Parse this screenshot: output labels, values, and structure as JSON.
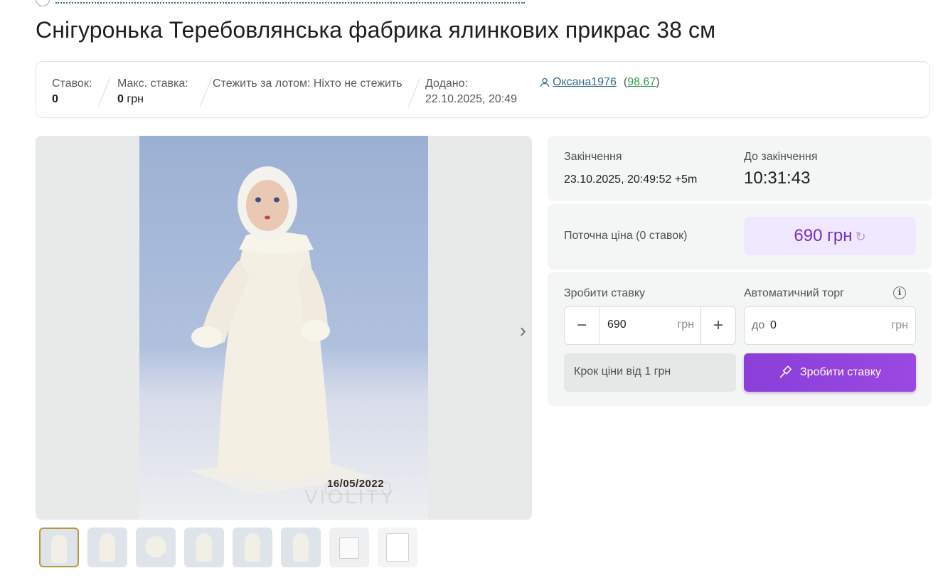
{
  "title": "Снігуронька Теребовлянська фабрика ялинкових прикрас 38 см",
  "stats": {
    "bids_label": "Ставок:",
    "bids_value": "0",
    "max_bid_label": "Макс. ставка:",
    "max_bid_value": "0",
    "max_bid_currency": "грн",
    "watch_text": "Стежить за лотом: Ніхто не стежить",
    "added_label": "Додано:",
    "added_value": "22.10.2025, 20:49",
    "seller_name": "Оксана1976",
    "seller_rating": "98.67"
  },
  "gallery": {
    "photo_date": "16/05/2022",
    "watermark": "VIOLITY",
    "thumb_count": 8
  },
  "auction": {
    "end_label": "Закінчення",
    "end_value": "23.10.2025, 20:49:52 +5m",
    "remaining_label": "До закінчення",
    "remaining_value": "10:31:43",
    "current_price_label": "Поточна ціна (0 ставок)",
    "current_price_value": "690 грн",
    "make_bid_label": "Зробити ставку",
    "bid_amount": "690",
    "currency": "грн",
    "auto_label": "Автоматичний торг",
    "auto_prefix": "до",
    "auto_value": "0",
    "step_note": "Крок ціни від 1 грн",
    "bid_button": "Зробити ставку"
  },
  "colors": {
    "accent_purple": "#8a3fd8",
    "price_text": "#7a2cc6",
    "link_green": "#2f9a4c"
  }
}
